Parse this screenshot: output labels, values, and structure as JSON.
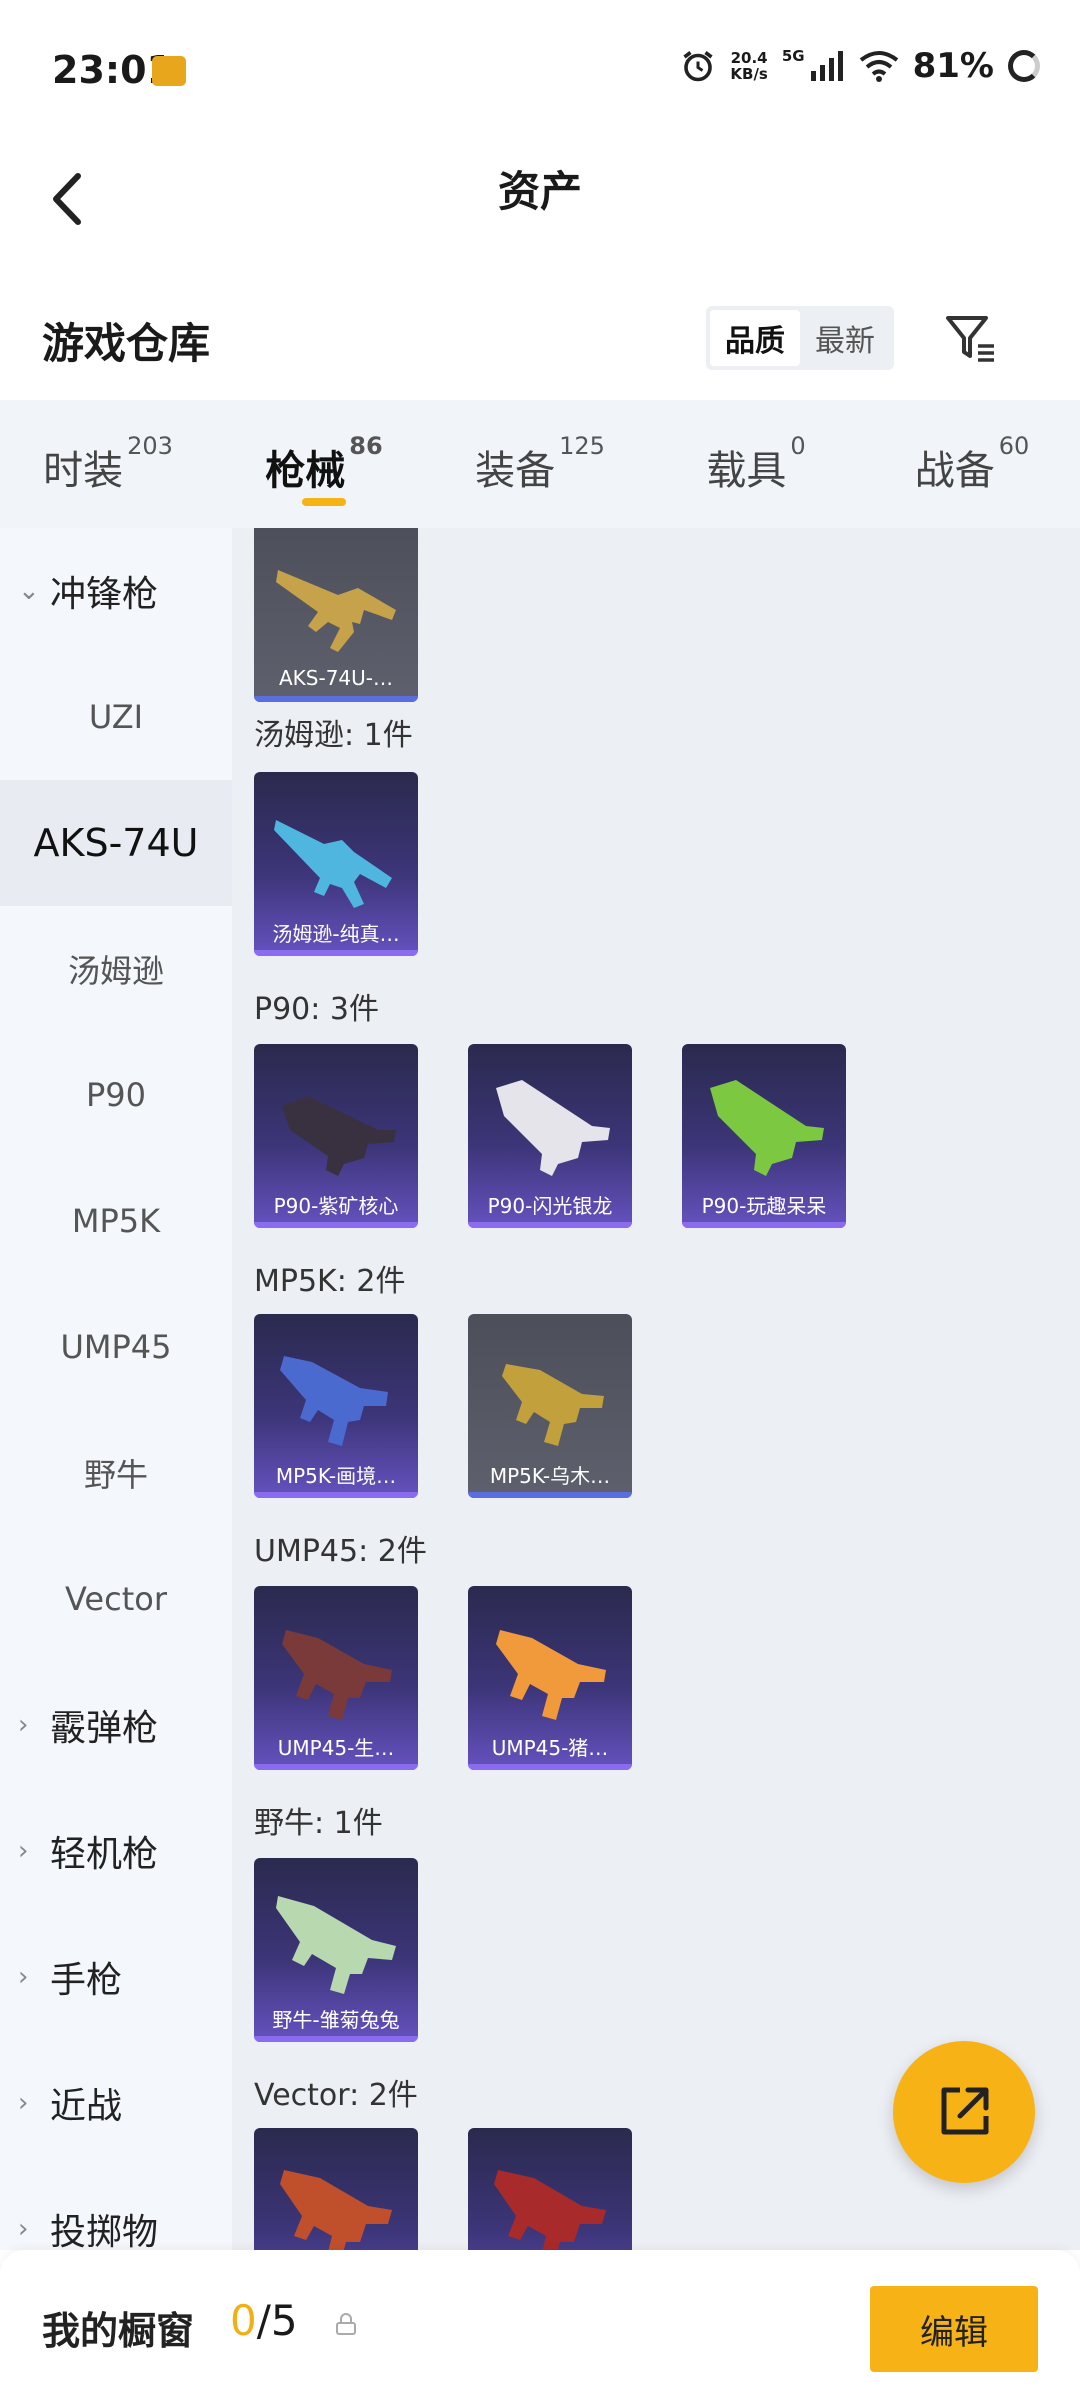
{
  "status_bar": {
    "time": "23:01",
    "net_speed_value": "20.4",
    "net_speed_unit": "KB/s",
    "network_type": "5G",
    "battery": "81%"
  },
  "header": {
    "title": "资产"
  },
  "warehouse": {
    "title": "游戏仓库",
    "sort_options": [
      "品质",
      "最新"
    ],
    "active_sort": "品质"
  },
  "tabs": [
    {
      "label": "时装",
      "count": "203",
      "active": false
    },
    {
      "label": "枪械",
      "count": "86",
      "active": true
    },
    {
      "label": "装备",
      "count": "125",
      "active": false
    },
    {
      "label": "载具",
      "count": "0",
      "active": false
    },
    {
      "label": "战备",
      "count": "60",
      "active": false
    }
  ],
  "sidebar": {
    "items": [
      {
        "label": "冲锋枪",
        "type": "group",
        "expanded": true
      },
      {
        "label": "UZI",
        "type": "sub"
      },
      {
        "label": "AKS-74U",
        "type": "sub",
        "active": true
      },
      {
        "label": "汤姆逊",
        "type": "sub"
      },
      {
        "label": "P90",
        "type": "sub"
      },
      {
        "label": "MP5K",
        "type": "sub"
      },
      {
        "label": "UMP45",
        "type": "sub"
      },
      {
        "label": "野牛",
        "type": "sub"
      },
      {
        "label": "Vector",
        "type": "sub"
      },
      {
        "label": "霰弹枪",
        "type": "group"
      },
      {
        "label": "轻机枪",
        "type": "group"
      },
      {
        "label": "手枪",
        "type": "group"
      },
      {
        "label": "近战",
        "type": "group"
      },
      {
        "label": "投掷物",
        "type": "group"
      }
    ]
  },
  "groups": [
    {
      "label": "汤姆逊: 1件"
    },
    {
      "label": "P90: 3件"
    },
    {
      "label": "MP5K: 2件"
    },
    {
      "label": "UMP45: 2件"
    },
    {
      "label": "野牛: 1件"
    },
    {
      "label": "Vector: 2件"
    }
  ],
  "items": [
    {
      "name": "AKS-74U-…",
      "style": "gray",
      "gun_color": "#c6a24a"
    },
    {
      "name": "汤姆逊-纯真…",
      "style": "purple",
      "gun_color": "#4fb6e0"
    },
    {
      "name": "P90-紫矿核心",
      "style": "purple",
      "gun_color": "#3a3140"
    },
    {
      "name": "P90-闪光银龙",
      "style": "purple",
      "gun_color": "#e4e4ea"
    },
    {
      "name": "P90-玩趣呆呆",
      "style": "purple",
      "gun_color": "#7cc840"
    },
    {
      "name": "MP5K-画境…",
      "style": "purple",
      "gun_color": "#4a6ad0"
    },
    {
      "name": "MP5K-乌木…",
      "style": "gray",
      "gun_color": "#c2a13c"
    },
    {
      "name": "UMP45-生…",
      "style": "purple",
      "gun_color": "#7a3a3a"
    },
    {
      "name": "UMP45-猪…",
      "style": "purple",
      "gun_color": "#f09a3c"
    },
    {
      "name": "野牛-雏菊兔兔",
      "style": "purple",
      "gun_color": "#b8d8b0"
    },
    {
      "name": "",
      "style": "purple",
      "gun_color": "#c0502c"
    },
    {
      "name": "",
      "style": "purple",
      "gun_color": "#a82a2a"
    }
  ],
  "bottom_bar": {
    "label": "我的橱窗",
    "current": "0",
    "total": "/5",
    "edit_label": "编辑"
  },
  "colors": {
    "accent": "#f7b215"
  }
}
